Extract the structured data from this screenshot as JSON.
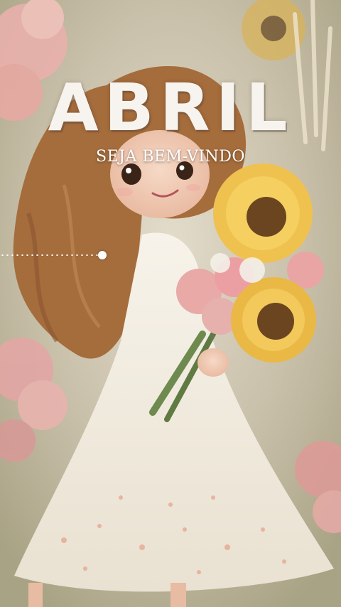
{
  "story": {
    "title": "ABRIL",
    "subtitle": "SEJA BEM-VINDO",
    "progress": 0.3
  },
  "illustration": {
    "subject": "girl-with-flower-bouquet",
    "colors": {
      "hair": "#a0673a",
      "dress": "#f3ede2",
      "sunflower": "#e8b84a",
      "pink_flowers": "#e6a1a4",
      "background": "#cfc6b4"
    }
  }
}
